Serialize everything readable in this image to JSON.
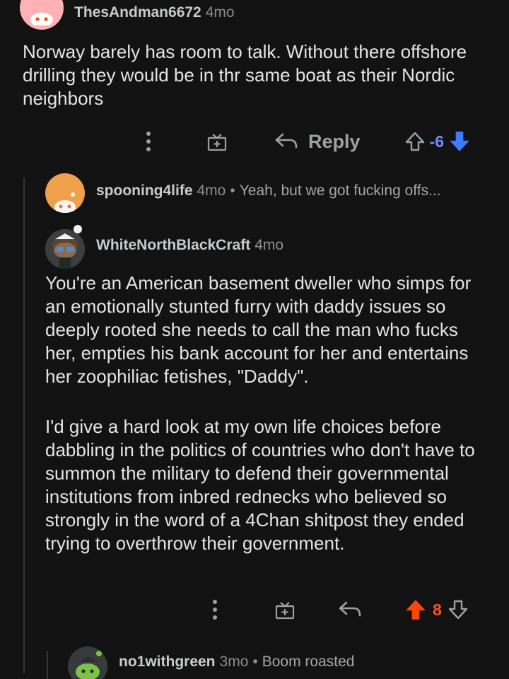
{
  "comments": [
    {
      "username": "ThesAndman6672",
      "age": "4mo",
      "body": "Norway barely has room to talk. Without there offshore drilling they would be in thr same boat as their Nordic neighbors",
      "reply_label": "Reply",
      "score": "-6",
      "vote_state": "downvoted"
    },
    {
      "username": "spooning4life",
      "age": "4mo",
      "separator": "•",
      "preview": "Yeah, but we got fucking offs...",
      "collapsed": true
    },
    {
      "username": "WhiteNorthBlackCraft",
      "age": "4mo",
      "paragraphs": [
        "You're an American basement dweller who simps for an emotionally stunted furry with daddy issues so deeply rooted she needs to call the man who fucks her, empties his bank account for her and entertains her zoophiliac fetishes, \"Daddy\".",
        "I'd give a hard look at my own life choices before dabbling in the politics of countries who don't have to summon the military to defend their governmental institutions from inbred rednecks who believed so strongly in the word of a 4Chan shitpost they ended trying to overthrow their government."
      ],
      "score": "8",
      "vote_state": "upvoted"
    },
    {
      "username": "no1withgreen",
      "age": "3mo",
      "separator": "•",
      "preview": "Boom roasted",
      "collapsed": true
    }
  ],
  "colors": {
    "background": "#121212",
    "upvote": "#ff4500",
    "downvote": "#3d7bff",
    "text": "#d7dadc",
    "muted": "#8b8d8f"
  },
  "icons": [
    "snoo-avatar-icon",
    "more-options-icon",
    "gift-award-icon",
    "reply-arrow-icon",
    "upvote-arrow-icon",
    "downvote-arrow-icon"
  ]
}
